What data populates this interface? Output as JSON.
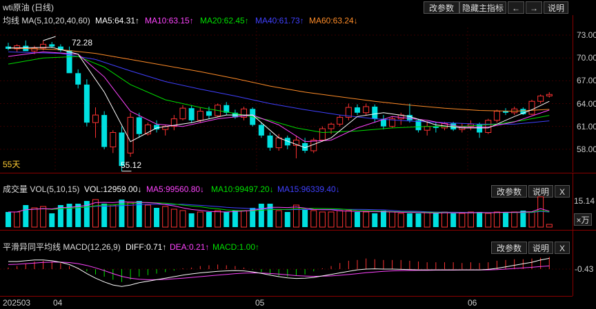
{
  "title_bar": {
    "title": "wti原油 (日线)",
    "btn_params": "改参数",
    "btn_hide": "隐藏主指标",
    "btn_back": "←",
    "btn_forward": "→",
    "btn_help": "说明"
  },
  "ma_legend": {
    "label": "均线 MA(5,10,20,40,60)",
    "ma5": "MA5:64.31↑",
    "ma10": "MA10:63.15↑",
    "ma20": "MA20:62.45↑",
    "ma40": "MA40:61.73↑",
    "ma60": "MA60:63.24↓"
  },
  "price_axis": [
    "73.00",
    "70.00",
    "67.00",
    "64.00",
    "61.00",
    "58.00"
  ],
  "annotations": {
    "high": "72.28",
    "low": "55.12",
    "days": "55天"
  },
  "vol_panel": {
    "label": "成交量 VOL(5,10,15)",
    "vol": "VOL:12959.00↓",
    "ma5": "MA5:99560.80↓",
    "ma10": "MA10:99497.20↓",
    "ma15": "MA15:96339.40↓",
    "btn_params": "改参数",
    "btn_help": "说明",
    "btn_close": "X",
    "axis_value": "15.14",
    "unit": "×万"
  },
  "macd_panel": {
    "label": "平滑异同平均线 MACD(12,26,9)",
    "diff": "DIFF:0.71↑",
    "dea": "DEA:0.21↑",
    "macd": "MACD:1.00↑",
    "btn_params": "改参数",
    "btn_help": "说明",
    "btn_close": "X",
    "axis_value": "-0.43"
  },
  "date_axis": [
    "202503",
    "04",
    "05",
    "06"
  ],
  "colors": {
    "up": "#ff3232",
    "down": "#00e0e0",
    "ma5": "#ffffff",
    "ma10": "#ff44ff",
    "ma20": "#00e000",
    "ma40": "#4040ff",
    "ma60": "#ff8c28"
  },
  "chart_data": {
    "type": "candlestick",
    "ylim": [
      55,
      74
    ],
    "candles": [
      [
        71.5,
        72.0,
        71.0,
        71.2
      ],
      [
        71.2,
        71.8,
        70.8,
        71.6
      ],
      [
        71.6,
        72.3,
        71.3,
        70.9
      ],
      [
        70.9,
        71.6,
        70.5,
        71.3
      ],
      [
        71.3,
        72.28,
        71.0,
        71.8
      ],
      [
        71.8,
        72.1,
        71.3,
        71.5
      ],
      [
        71.5,
        71.8,
        70.8,
        71.0
      ],
      [
        71.0,
        71.5,
        68.5,
        68.0
      ],
      [
        68.0,
        68.5,
        66.0,
        66.5
      ],
      [
        66.5,
        67.2,
        61.0,
        61.5
      ],
      [
        61.5,
        63.5,
        59.5,
        62.5
      ],
      [
        62.5,
        63.0,
        58.0,
        58.3
      ],
      [
        58.3,
        60.5,
        57.5,
        60.2
      ],
      [
        60.2,
        61.0,
        55.12,
        55.8
      ],
      [
        57.5,
        62.8,
        57.0,
        62.2
      ],
      [
        62.2,
        62.8,
        59.5,
        60.0
      ],
      [
        60.0,
        61.5,
        59.8,
        61.2
      ],
      [
        61.2,
        61.8,
        60.2,
        60.6
      ],
      [
        60.6,
        61.2,
        59.8,
        61.0
      ],
      [
        61.0,
        62.5,
        60.5,
        62.0
      ],
      [
        62.0,
        63.8,
        61.8,
        63.4
      ],
      [
        63.4,
        63.8,
        61.5,
        61.8
      ],
      [
        61.8,
        63.5,
        61.5,
        63.0
      ],
      [
        63.0,
        63.6,
        62.0,
        62.4
      ],
      [
        62.4,
        64.0,
        62.2,
        63.8
      ],
      [
        63.8,
        64.2,
        62.5,
        62.8
      ],
      [
        62.8,
        63.2,
        62.0,
        62.2
      ],
      [
        62.2,
        63.6,
        61.8,
        63.3
      ],
      [
        63.3,
        63.5,
        61.0,
        61.2
      ],
      [
        61.2,
        61.5,
        59.5,
        59.8
      ],
      [
        59.8,
        60.2,
        57.8,
        58.2
      ],
      [
        58.2,
        60.0,
        57.8,
        59.5
      ],
      [
        59.5,
        59.8,
        58.0,
        58.5
      ],
      [
        58.5,
        59.8,
        56.8,
        59.2
      ],
      [
        58.8,
        59.5,
        57.5,
        57.8
      ],
      [
        57.8,
        59.5,
        57.5,
        59.2
      ],
      [
        59.2,
        61.0,
        59.0,
        60.7
      ],
      [
        60.7,
        61.5,
        60.0,
        61.3
      ],
      [
        61.3,
        62.5,
        61.0,
        62.2
      ],
      [
        62.2,
        64.0,
        61.8,
        63.5
      ],
      [
        63.5,
        63.9,
        62.5,
        62.8
      ],
      [
        62.8,
        64.0,
        62.5,
        63.6
      ],
      [
        63.6,
        63.9,
        61.5,
        62.0
      ],
      [
        62.0,
        62.5,
        60.6,
        61.0
      ],
      [
        61.0,
        62.3,
        60.8,
        62.0
      ],
      [
        62.0,
        62.8,
        61.2,
        62.5
      ],
      [
        62.5,
        64.0,
        61.5,
        61.8
      ],
      [
        61.8,
        62.0,
        60.2,
        60.5
      ],
      [
        60.5,
        61.7,
        59.8,
        61.0
      ],
      [
        61.0,
        61.6,
        60.2,
        60.8
      ],
      [
        60.8,
        61.6,
        60.5,
        61.4
      ],
      [
        61.4,
        61.6,
        60.4,
        60.6
      ],
      [
        60.6,
        61.4,
        60.2,
        61.0
      ],
      [
        61.0,
        61.8,
        60.5,
        61.3
      ],
      [
        61.3,
        61.5,
        59.5,
        60.2
      ],
      [
        60.2,
        62.0,
        60.0,
        61.8
      ],
      [
        61.8,
        63.2,
        61.5,
        63.0
      ],
      [
        63.0,
        63.4,
        62.5,
        62.8
      ],
      [
        62.8,
        63.6,
        62.5,
        63.3
      ],
      [
        63.3,
        63.5,
        62.5,
        62.6
      ],
      [
        62.6,
        64.5,
        62.5,
        64.3
      ],
      [
        64.3,
        65.2,
        64.0,
        65.0
      ],
      [
        65.0,
        65.5,
        64.8,
        65.2
      ]
    ],
    "ma": {
      "ma5": [
        [
          0,
          71.3
        ],
        [
          5,
          71.4
        ],
        [
          8,
          70.5
        ],
        [
          11,
          65.5
        ],
        [
          14,
          59.0
        ],
        [
          17,
          60.8
        ],
        [
          21,
          61.5
        ],
        [
          25,
          62.5
        ],
        [
          28,
          62.5
        ],
        [
          31,
          59.5
        ],
        [
          34,
          58.2
        ],
        [
          37,
          59.5
        ],
        [
          40,
          62.3
        ],
        [
          43,
          62.8
        ],
        [
          46,
          62.3
        ],
        [
          49,
          61.2
        ],
        [
          52,
          60.8
        ],
        [
          55,
          60.8
        ],
        [
          58,
          62.3
        ],
        [
          60,
          63.2
        ],
        [
          62,
          64.3
        ]
      ],
      "ma10": [
        [
          0,
          70.2
        ],
        [
          4,
          70.8
        ],
        [
          8,
          70.5
        ],
        [
          11,
          67.5
        ],
        [
          14,
          63.0
        ],
        [
          17,
          61.3
        ],
        [
          20,
          61.0
        ],
        [
          24,
          62.0
        ],
        [
          28,
          62.5
        ],
        [
          31,
          61.2
        ],
        [
          34,
          59.0
        ],
        [
          37,
          59.2
        ],
        [
          40,
          60.8
        ],
        [
          44,
          62.3
        ],
        [
          48,
          61.8
        ],
        [
          52,
          60.9
        ],
        [
          55,
          60.9
        ],
        [
          58,
          61.6
        ],
        [
          62,
          63.15
        ]
      ],
      "ma20": [
        [
          0,
          69.2
        ],
        [
          4,
          70.0
        ],
        [
          8,
          70.2
        ],
        [
          11,
          68.8
        ],
        [
          14,
          66.5
        ],
        [
          18,
          64.5
        ],
        [
          22,
          63.5
        ],
        [
          26,
          62.7
        ],
        [
          30,
          61.8
        ],
        [
          33,
          60.8
        ],
        [
          36,
          60.2
        ],
        [
          40,
          60.4
        ],
        [
          44,
          60.8
        ],
        [
          48,
          61.0
        ],
        [
          52,
          61.0
        ],
        [
          56,
          61.3
        ],
        [
          59,
          61.8
        ],
        [
          62,
          62.45
        ]
      ],
      "ma40": [
        [
          0,
          70.8
        ],
        [
          6,
          70.6
        ],
        [
          10,
          69.8
        ],
        [
          14,
          68.3
        ],
        [
          18,
          66.9
        ],
        [
          22,
          65.9
        ],
        [
          26,
          65.0
        ],
        [
          30,
          64.0
        ],
        [
          34,
          63.2
        ],
        [
          38,
          62.5
        ],
        [
          42,
          62.0
        ],
        [
          46,
          61.7
        ],
        [
          50,
          61.5
        ],
        [
          54,
          61.3
        ],
        [
          58,
          61.3
        ],
        [
          62,
          61.73
        ]
      ],
      "ma60": [
        [
          0,
          71.3
        ],
        [
          6,
          71.1
        ],
        [
          10,
          70.6
        ],
        [
          14,
          69.8
        ],
        [
          18,
          69.0
        ],
        [
          22,
          68.2
        ],
        [
          26,
          67.3
        ],
        [
          30,
          66.3
        ],
        [
          34,
          65.5
        ],
        [
          38,
          64.9
        ],
        [
          42,
          64.3
        ],
        [
          46,
          63.8
        ],
        [
          50,
          63.4
        ],
        [
          54,
          63.1
        ],
        [
          58,
          63.0
        ],
        [
          62,
          63.24
        ]
      ]
    },
    "volume": [
      0.55,
      0.55,
      0.8,
      0.7,
      0.75,
      0.5,
      0.8,
      0.85,
      0.85,
      0.95,
      1.0,
      0.85,
      0.8,
      1.0,
      0.9,
      0.95,
      0.8,
      0.7,
      0.75,
      0.65,
      0.6,
      0.5,
      0.55,
      0.55,
      0.6,
      0.55,
      0.6,
      0.6,
      0.7,
      0.85,
      0.85,
      0.6,
      0.55,
      0.8,
      0.65,
      0.6,
      0.55,
      0.55,
      0.6,
      0.6,
      0.55,
      0.55,
      0.5,
      0.6,
      0.55,
      0.5,
      0.5,
      0.5,
      0.55,
      0.5,
      0.55,
      0.5,
      0.5,
      0.55,
      0.55,
      0.5,
      0.55,
      0.55,
      0.55,
      0.6,
      0.55,
      1.1,
      0.1
    ],
    "macd_hist": [
      0.1,
      0.2,
      0.35,
      0.5,
      0.55,
      0.5,
      0.4,
      0.2,
      0.05,
      -0.15,
      -0.35,
      -0.5,
      -0.7,
      -0.85,
      -0.7,
      -0.5,
      -0.4,
      -0.3,
      -0.2,
      -0.1,
      0.05,
      0.1,
      0.2,
      0.25,
      0.3,
      0.25,
      0.2,
      0.1,
      -0.05,
      -0.2,
      -0.35,
      -0.45,
      -0.5,
      -0.45,
      -0.35,
      -0.15,
      0.05,
      0.2,
      0.4,
      0.55,
      0.6,
      0.7,
      0.65,
      0.6,
      0.6,
      0.6,
      0.55,
      0.5,
      0.45,
      0.45,
      0.45,
      0.45,
      0.4,
      0.45,
      0.4,
      0.45,
      0.55,
      0.6,
      0.65,
      0.65,
      0.7,
      0.75,
      0.8
    ],
    "diff": [
      0.5,
      0.5,
      0.55,
      0.6,
      0.6,
      0.55,
      0.45,
      0.3,
      0.05,
      -0.3,
      -0.6,
      -0.85,
      -1.05,
      -1.15,
      -1.05,
      -0.9,
      -0.8,
      -0.7,
      -0.6,
      -0.5,
      -0.4,
      -0.32,
      -0.25,
      -0.2,
      -0.15,
      -0.12,
      -0.1,
      -0.12,
      -0.18,
      -0.28,
      -0.4,
      -0.5,
      -0.58,
      -0.62,
      -0.6,
      -0.55,
      -0.45,
      -0.35,
      -0.25,
      -0.15,
      -0.05,
      0.0,
      0.02,
      0.0,
      0.0,
      -0.02,
      -0.03,
      -0.05,
      -0.05,
      -0.05,
      -0.05,
      -0.05,
      -0.05,
      -0.05,
      -0.05,
      -0.02,
      0.05,
      0.15,
      0.25,
      0.35,
      0.45,
      0.6,
      0.71
    ],
    "dea": [
      0.3,
      0.32,
      0.36,
      0.4,
      0.44,
      0.46,
      0.46,
      0.43,
      0.36,
      0.24,
      0.08,
      -0.1,
      -0.3,
      -0.48,
      -0.6,
      -0.67,
      -0.7,
      -0.7,
      -0.68,
      -0.64,
      -0.6,
      -0.55,
      -0.5,
      -0.45,
      -0.4,
      -0.35,
      -0.3,
      -0.27,
      -0.25,
      -0.26,
      -0.29,
      -0.33,
      -0.38,
      -0.43,
      -0.46,
      -0.48,
      -0.47,
      -0.45,
      -0.41,
      -0.36,
      -0.3,
      -0.24,
      -0.19,
      -0.15,
      -0.12,
      -0.1,
      -0.09,
      -0.08,
      -0.08,
      -0.07,
      -0.07,
      -0.07,
      -0.06,
      -0.06,
      -0.06,
      -0.05,
      -0.03,
      0.0,
      0.04,
      0.08,
      0.12,
      0.17,
      0.21
    ]
  }
}
